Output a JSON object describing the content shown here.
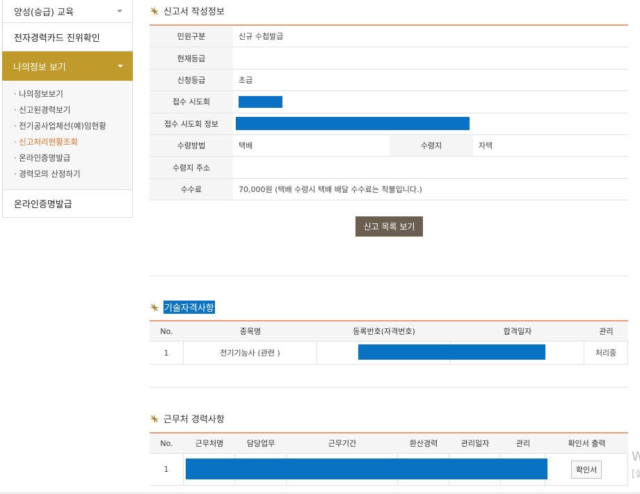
{
  "sidebar": {
    "top_item": "양성(승급) 교육",
    "card_check": "전자경력카드 진위확인",
    "active_item": "나의정보 보기",
    "submenu": [
      {
        "label": "· 나의정보보기",
        "current": false
      },
      {
        "label": "· 신고된경력보기",
        "current": false
      },
      {
        "label": "· 전기공사업체선(예)임현황",
        "current": false
      },
      {
        "label": "· 신고처리현황조회",
        "current": true
      },
      {
        "label": "· 온라인증명발급",
        "current": false
      },
      {
        "label": "· 경력모의 산정하기",
        "current": false
      }
    ],
    "bottom_item": "온라인증명발급"
  },
  "report": {
    "title": "신고서 작성정보",
    "rows": {
      "type_label": "민원구분",
      "type_value": "신규 수첩발급",
      "grade_label": "현재등급",
      "grade_value": "",
      "apply_grade_label": "신청등급",
      "apply_grade_value": "초급",
      "office_label": "접수 시도회",
      "office_info_label": "접수 시도회 정보",
      "receive_method_label": "수령방법",
      "receive_method_value": "택배",
      "receive_place_label": "수령지",
      "receive_place_value": "자택",
      "address_label": "수령지 주소",
      "address_value": "",
      "fee_label": "수수료",
      "fee_value": "70,000원 (택배 수령시 택배 배달 수수료는 착불입니다.)"
    },
    "list_button": "신고 목록 보기"
  },
  "qualification": {
    "title": "기술자격사항",
    "headers": [
      "No.",
      "종목명",
      "등록번호(자격번호)",
      "합격일자",
      "관리"
    ],
    "rows": [
      {
        "no": "1",
        "name": "전기기능사 (관련 )",
        "status": "처리중"
      }
    ]
  },
  "career": {
    "title": "근무처 경력사항",
    "headers": [
      "No.",
      "근무처명",
      "담당업무",
      "근무기간",
      "환산경력",
      "관리일자",
      "관리",
      "확인서 출력"
    ],
    "rows": [
      {
        "no": "1",
        "print_button": "확인서"
      }
    ]
  },
  "edge_text": {
    "line1": "W",
    "line2": "[설"
  },
  "colors": {
    "accent": "#c09a2a",
    "redaction": "#0a72c2",
    "table_top_border": "#e8a07a",
    "dark_button": "#6b5f52",
    "current_submenu": "#e06b21"
  }
}
